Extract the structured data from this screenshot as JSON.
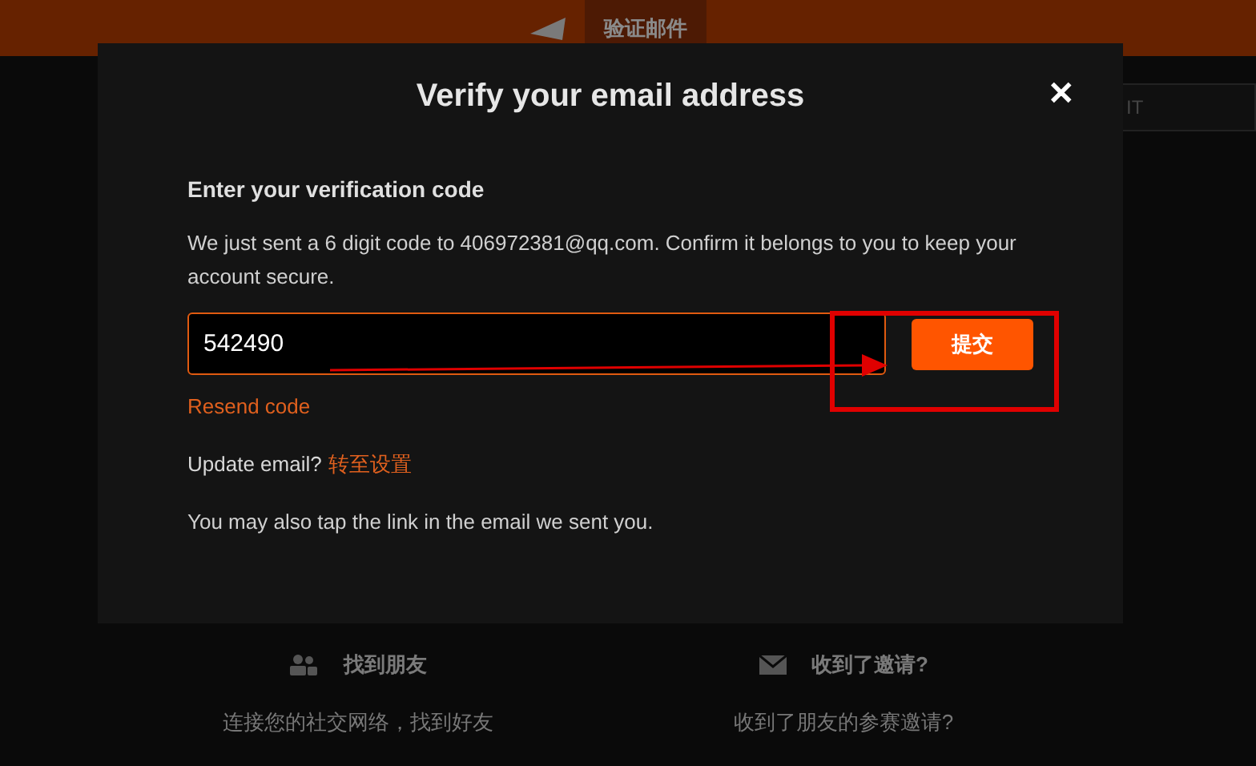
{
  "header": {
    "tab": "验证邮件"
  },
  "background_button": "IT",
  "modal": {
    "title": "Verify your email address",
    "close": "✕",
    "heading": "Enter your verification code",
    "message": "We just sent a 6 digit code to 406972381@qq.com. Confirm it belongs to you to keep your account secure.",
    "code_value": "542490",
    "submit": "提交",
    "resend": "Resend code",
    "update_label": "Update email?",
    "update_link": "转至设置",
    "note": "You may also tap the link in the email we sent you."
  },
  "features": [
    {
      "kind": "friends",
      "title": "找到朋友",
      "text": "连接您的社交网络，找到好友"
    },
    {
      "kind": "invite",
      "title": "收到了邀请?",
      "text": "收到了朋友的参赛邀请?"
    }
  ]
}
